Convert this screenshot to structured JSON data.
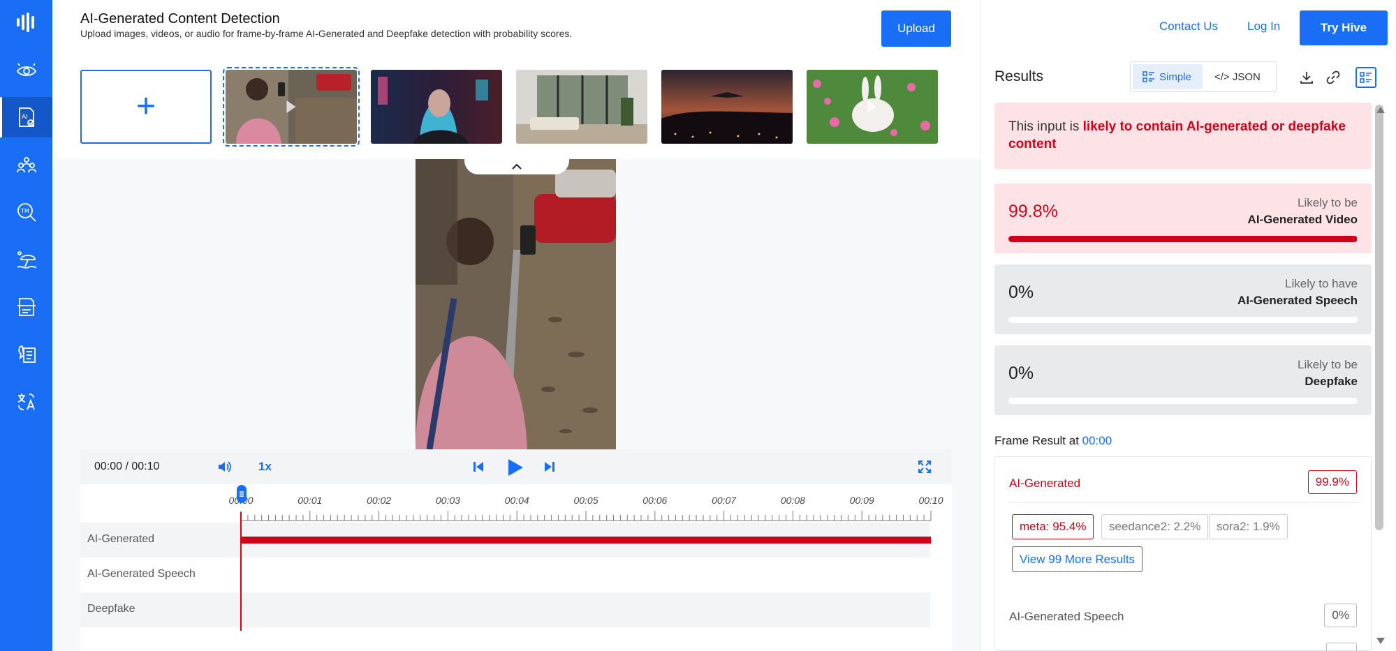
{
  "app": {
    "title": "AI-Generated Content Detection",
    "subtitle": "Upload images, videos, or audio for frame-by-frame AI-Generated and Deepfake detection with probability scores.",
    "upload_label": "Upload"
  },
  "sidebar": {
    "items": [
      {
        "icon": "eye-scan-icon"
      },
      {
        "icon": "ai-detect-icon",
        "active": true
      },
      {
        "icon": "people-icon"
      },
      {
        "icon": "trademark-search-icon"
      },
      {
        "icon": "beach-umbrella-icon"
      },
      {
        "icon": "document-scan-icon"
      },
      {
        "icon": "speech-document-icon"
      },
      {
        "icon": "translate-icon"
      }
    ]
  },
  "thumbnails": [
    {
      "kind": "add",
      "glyph": "+"
    },
    {
      "kind": "video",
      "selected": true
    },
    {
      "kind": "image"
    },
    {
      "kind": "image"
    },
    {
      "kind": "image"
    },
    {
      "kind": "video"
    }
  ],
  "player": {
    "time": "00:00 / 00:10",
    "speed": "1x",
    "ticks": [
      "00:00",
      "00:01",
      "00:02",
      "00:03",
      "00:04",
      "00:05",
      "00:06",
      "00:07",
      "00:08",
      "00:09",
      "00:10"
    ],
    "tracks": [
      {
        "label": "AI-Generated",
        "flagged": true
      },
      {
        "label": "AI-Generated Speech",
        "flagged": false
      },
      {
        "label": "Deepfake",
        "flagged": false
      }
    ]
  },
  "nav": {
    "contact": "Contact Us",
    "login": "Log In",
    "try": "Try Hive"
  },
  "results": {
    "title": "Results",
    "view_simple": "Simple",
    "view_json": "</> JSON",
    "verdict_prefix": "This input is ",
    "verdict_highlight": "likely to contain AI-generated or deepfake content",
    "scores": [
      {
        "pct": "99.8%",
        "value": 0.998,
        "line1": "Likely to be",
        "line2": "AI-Generated Video",
        "hot": true
      },
      {
        "pct": "0%",
        "value": 0,
        "line1": "Likely to have",
        "line2": "AI-Generated Speech",
        "hot": false
      },
      {
        "pct": "0%",
        "value": 0,
        "line1": "Likely to be",
        "line2": "Deepfake",
        "hot": false
      }
    ],
    "frame_title_prefix": "Frame Result at ",
    "frame_time": "00:00",
    "frame": {
      "ai_label": "AI-Generated",
      "ai_score": "99.9%",
      "chips": [
        "meta: 95.4%",
        "seedance2: 2.2%",
        "sora2: 1.9%"
      ],
      "more": "View 99 More Results",
      "speech_label": "AI-Generated Speech",
      "speech_score": "0%"
    }
  },
  "colors": {
    "accent": "#1a6ef5",
    "danger": "#d0021b",
    "danger_bg": "#fde3e6"
  }
}
